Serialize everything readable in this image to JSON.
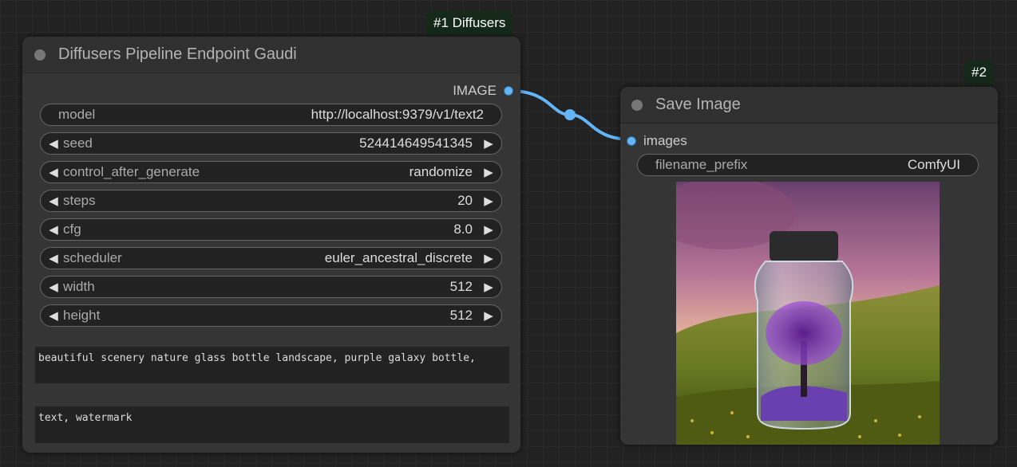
{
  "node1": {
    "badge": "#1 Diffusers",
    "title": "Diffusers Pipeline Endpoint Gaudi",
    "output_label": "IMAGE",
    "model": {
      "label": "model",
      "value": "http://localhost:9379/v1/text2"
    },
    "widgets": [
      {
        "label": "seed",
        "value": "524414649541345"
      },
      {
        "label": "control_after_generate",
        "value": "randomize"
      },
      {
        "label": "steps",
        "value": "20"
      },
      {
        "label": "cfg",
        "value": "8.0"
      },
      {
        "label": "scheduler",
        "value": "euler_ancestral_discrete"
      },
      {
        "label": "width",
        "value": "512"
      },
      {
        "label": "height",
        "value": "512"
      }
    ],
    "positive_prompt": "beautiful scenery nature glass bottle landscape, purple galaxy bottle,",
    "negative_prompt": "text, watermark"
  },
  "node2": {
    "badge": "#2",
    "title": "Save Image",
    "input_label": "images",
    "filename_prefix": {
      "label": "filename_prefix",
      "value": "ComfyUI"
    }
  },
  "colors": {
    "link": "#64b5f6",
    "badge_bg": "#15291b",
    "node_bg": "#353535"
  }
}
